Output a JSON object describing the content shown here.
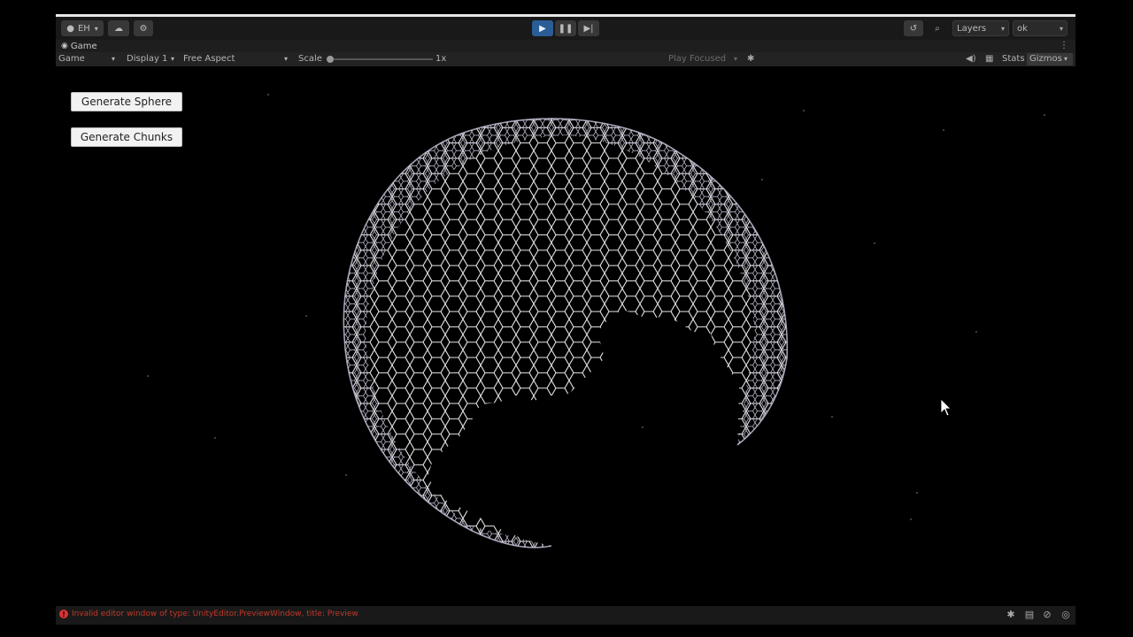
{
  "toolbar": {
    "account_label": "EH",
    "layers_label": "Layers",
    "layout_label": "ok"
  },
  "tab": {
    "game_label": "Game"
  },
  "controls": {
    "view_select": "Game",
    "display_select": "Display 1",
    "aspect_select": "Free Aspect",
    "scale_label": "Scale",
    "scale_value": "1x",
    "play_mode": "Play Focused",
    "stats_label": "Stats",
    "gizmos_label": "Gizmos"
  },
  "game": {
    "generate_sphere": "Generate Sphere",
    "generate_chunks": "Generate Chunks"
  },
  "status": {
    "error_text": "Invalid editor window of type: UnityEditor.PreviewWindow, title: Preview"
  },
  "colors": {
    "play_active": "#2a5d95",
    "error": "#c0392b",
    "mesh": "#e6e6e6"
  }
}
